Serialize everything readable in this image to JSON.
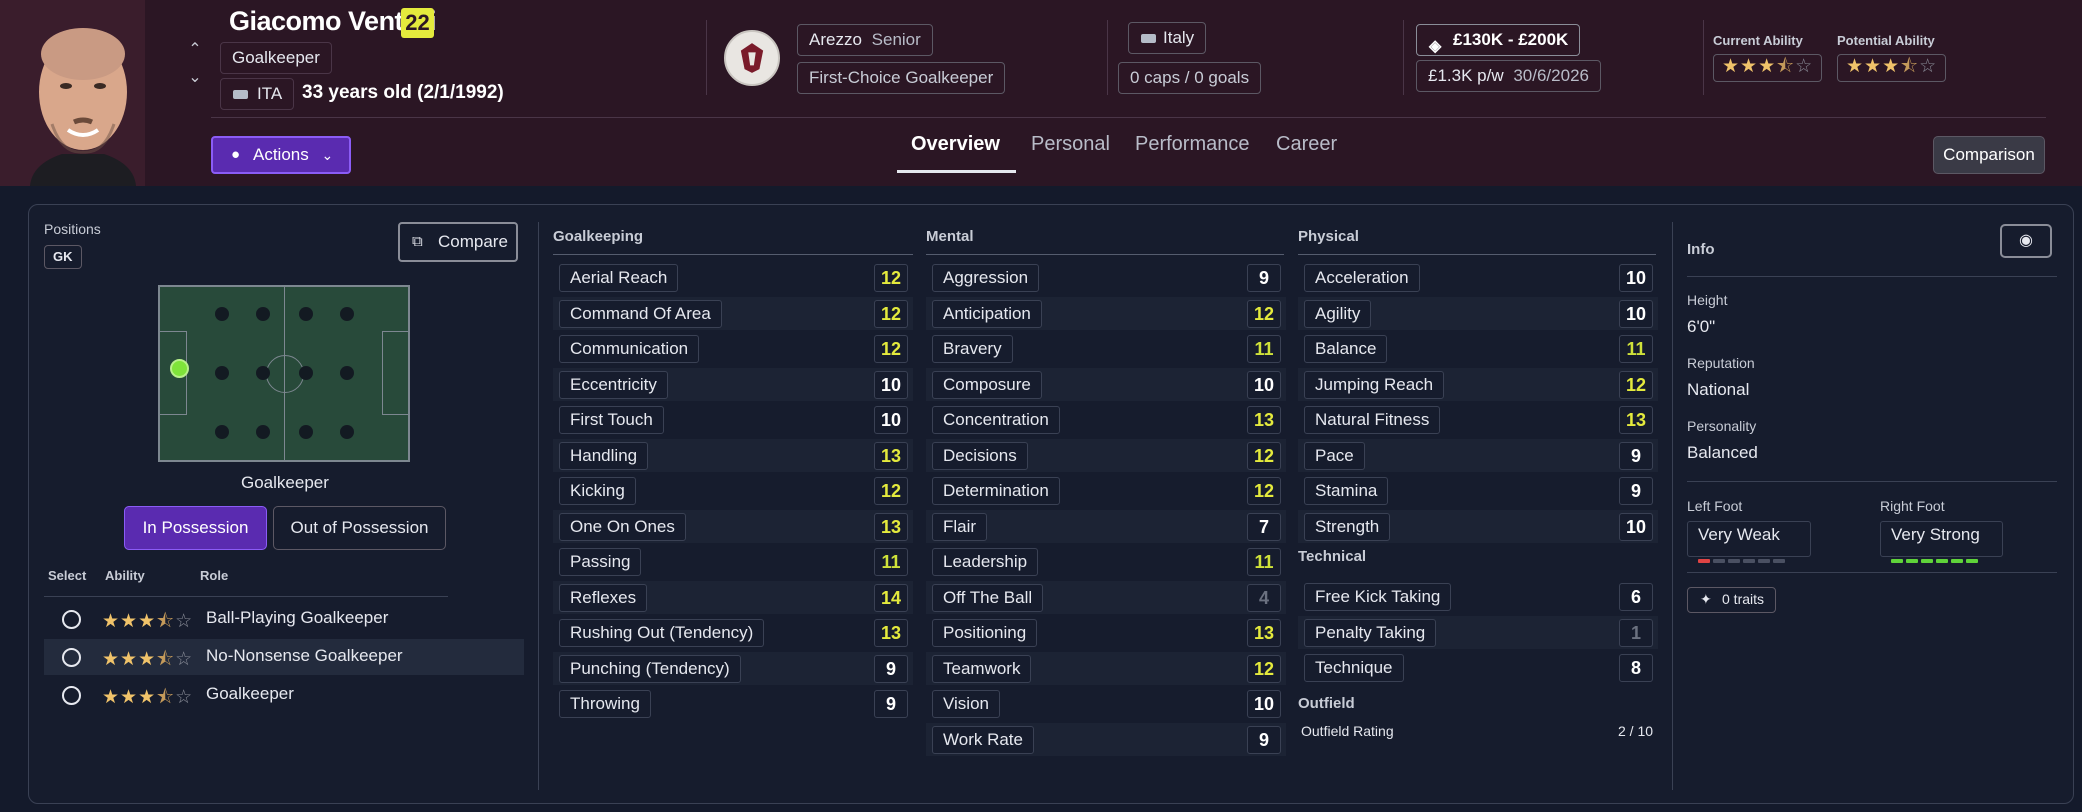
{
  "player": {
    "name": "Giacomo Venturi",
    "number": "22",
    "position": "Goalkeeper",
    "nationality_code": "ITA",
    "age_text": "33 years old (2/1/1992)",
    "club": "Arezzo",
    "squad": "Senior",
    "role_status": "First-Choice Goalkeeper",
    "country": "Italy",
    "caps": "0 caps / 0 goals",
    "value": "£130K - £200K",
    "wage": "£1.3K p/w",
    "contract_end": "30/6/2026",
    "current_ability_label": "Current Ability",
    "potential_ability_label": "Potential Ability",
    "current_ability_stars": 3.5,
    "potential_ability_stars": 3.5
  },
  "header": {
    "actions_label": "Actions",
    "tabs": [
      {
        "label": "Overview",
        "active": true
      },
      {
        "label": "Personal",
        "active": false
      },
      {
        "label": "Performance",
        "active": false
      },
      {
        "label": "Career",
        "active": false
      }
    ],
    "comparison_label": "Comparison"
  },
  "positions": {
    "title": "Positions",
    "pos_badge": "GK",
    "compare_label": "Compare",
    "pitch_caption": "Goalkeeper",
    "in_possession": "In Possession",
    "out_possession": "Out of Possession",
    "table_headers": {
      "select": "Select",
      "ability": "Ability",
      "role": "Role"
    },
    "roles": [
      {
        "name": "Ball-Playing Goalkeeper",
        "stars": 3.5
      },
      {
        "name": "No-Nonsense Goalkeeper",
        "stars": 3.5
      },
      {
        "name": "Goalkeeper",
        "stars": 3.5
      }
    ]
  },
  "goalkeeping": {
    "title": "Goalkeeping",
    "attributes": [
      {
        "name": "Aerial Reach",
        "value": "12"
      },
      {
        "name": "Command Of Area",
        "value": "12"
      },
      {
        "name": "Communication",
        "value": "12"
      },
      {
        "name": "Eccentricity",
        "value": "10"
      },
      {
        "name": "First Touch",
        "value": "10"
      },
      {
        "name": "Handling",
        "value": "13"
      },
      {
        "name": "Kicking",
        "value": "12"
      },
      {
        "name": "One On Ones",
        "value": "13"
      },
      {
        "name": "Passing",
        "value": "11"
      },
      {
        "name": "Reflexes",
        "value": "14"
      },
      {
        "name": "Rushing Out (Tendency)",
        "value": "13"
      },
      {
        "name": "Punching (Tendency)",
        "value": "9"
      },
      {
        "name": "Throwing",
        "value": "9"
      }
    ]
  },
  "mental": {
    "title": "Mental",
    "attributes": [
      {
        "name": "Aggression",
        "value": "9"
      },
      {
        "name": "Anticipation",
        "value": "12"
      },
      {
        "name": "Bravery",
        "value": "11"
      },
      {
        "name": "Composure",
        "value": "10"
      },
      {
        "name": "Concentration",
        "value": "13"
      },
      {
        "name": "Decisions",
        "value": "12"
      },
      {
        "name": "Determination",
        "value": "12"
      },
      {
        "name": "Flair",
        "value": "7"
      },
      {
        "name": "Leadership",
        "value": "11"
      },
      {
        "name": "Off The Ball",
        "value": "4"
      },
      {
        "name": "Positioning",
        "value": "13"
      },
      {
        "name": "Teamwork",
        "value": "12"
      },
      {
        "name": "Vision",
        "value": "10"
      },
      {
        "name": "Work Rate",
        "value": "9"
      }
    ]
  },
  "physical": {
    "title": "Physical",
    "attributes": [
      {
        "name": "Acceleration",
        "value": "10"
      },
      {
        "name": "Agility",
        "value": "10"
      },
      {
        "name": "Balance",
        "value": "11"
      },
      {
        "name": "Jumping Reach",
        "value": "12"
      },
      {
        "name": "Natural Fitness",
        "value": "13"
      },
      {
        "name": "Pace",
        "value": "9"
      },
      {
        "name": "Stamina",
        "value": "9"
      },
      {
        "name": "Strength",
        "value": "10"
      }
    ]
  },
  "technical": {
    "title": "Technical",
    "attributes": [
      {
        "name": "Free Kick Taking",
        "value": "6"
      },
      {
        "name": "Penalty Taking",
        "value": "1"
      },
      {
        "name": "Technique",
        "value": "8"
      }
    ]
  },
  "outfield": {
    "title": "Outfield",
    "rating_label": "Outfield Rating",
    "rating_value": "2 / 10"
  },
  "info": {
    "title": "Info",
    "height_label": "Height",
    "height": "6'0\"",
    "reputation_label": "Reputation",
    "reputation": "National",
    "personality_label": "Personality",
    "personality": "Balanced",
    "left_foot_label": "Left Foot",
    "left_foot": "Very Weak",
    "left_foot_level": 1,
    "right_foot_label": "Right Foot",
    "right_foot": "Very Strong",
    "right_foot_level": 6,
    "traits": "0 traits"
  },
  "colors": {
    "accent": "#5a2bb0",
    "highlight_value": "#e4ea3d",
    "header_bg": "#2b1624"
  }
}
